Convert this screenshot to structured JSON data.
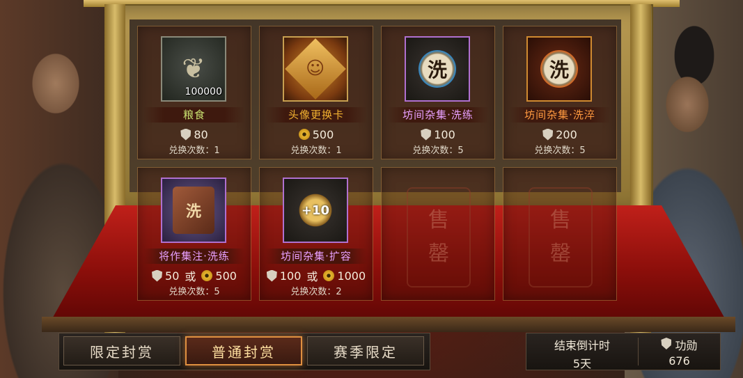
{
  "shop": {
    "items": [
      {
        "name": "粮食",
        "icon": "grain-icon",
        "qty": "100000",
        "price_shield": "80",
        "count": "兑换次数：1",
        "color": "#c8e070"
      },
      {
        "name": "头像更换卡",
        "icon": "avatar-card-icon",
        "price_coin": "500",
        "count": "兑换次数：1",
        "color": "#f0b030"
      },
      {
        "name": "坊间杂集·洗练",
        "icon": "refine-icon",
        "glyph": "洗",
        "price_shield": "100",
        "count": "兑换次数：5",
        "color": "#e8a0ff"
      },
      {
        "name": "坊间杂集·洗淬",
        "icon": "refine-fire-icon",
        "glyph": "洗",
        "price_shield": "200",
        "count": "兑换次数：5",
        "color": "#ff9a40"
      },
      {
        "name": "将作集注·洗练",
        "icon": "book-icon",
        "glyph": "洗",
        "price_shield": "50",
        "or": "或",
        "price_coin": "500",
        "count": "兑换次数：5",
        "color": "#e8a0ff"
      },
      {
        "name": "坊间杂集·扩容",
        "icon": "bag-icon",
        "glyph": "+10",
        "price_shield": "100",
        "or": "或",
        "price_coin": "1000",
        "count": "兑换次数：2",
        "color": "#e8a0ff"
      }
    ],
    "sold_out": [
      {
        "line1": "售",
        "line2": "罄"
      },
      {
        "line1": "售",
        "line2": "罄"
      }
    ]
  },
  "tabs": [
    {
      "label": "限定封赏",
      "active": false
    },
    {
      "label": "普通封赏",
      "active": true
    },
    {
      "label": "赛季限定",
      "active": false
    }
  ],
  "countdown": {
    "label": "结束倒计时",
    "value": "5天"
  },
  "merit": {
    "label": "功勋",
    "value": "676"
  }
}
